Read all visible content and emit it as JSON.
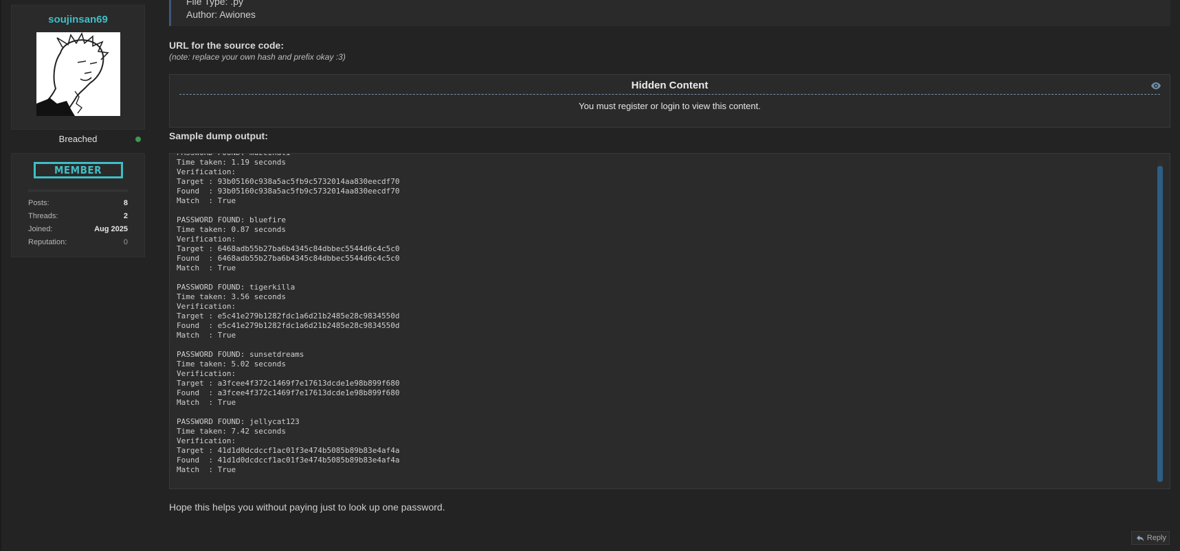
{
  "sidebar": {
    "username": "soujinsan69",
    "status": "Breached",
    "rank": "MEMBER",
    "stats": [
      {
        "label": "Posts:",
        "value": "8"
      },
      {
        "label": "Threads:",
        "value": "2"
      },
      {
        "label": "Joined:",
        "value": "Aug 2025"
      },
      {
        "label": "Reputation:",
        "value": "0"
      }
    ]
  },
  "quote": {
    "line1": "File Type: .py",
    "line2": "Author: Awiones"
  },
  "source": {
    "title": "URL for the source code:",
    "note": "(note: replace your own hash and prefix okay :3)"
  },
  "hidden": {
    "title": "Hidden Content",
    "message": "You must register or login to view this content."
  },
  "dump": {
    "title": "Sample dump output:",
    "code": "PASSWORD FOUND: muzcinati\nTime taken: 1.19 seconds\nVerification:\nTarget : 93b05160c938a5ac5fb9c5732014aa830eecdf70\nFound  : 93b05160c938a5ac5fb9c5732014aa830eecdf70\nMatch  : True\n\nPASSWORD FOUND: bluefire\nTime taken: 0.87 seconds\nVerification:\nTarget : 6468adb55b27ba6b4345c84dbbec5544d6c4c5c0\nFound  : 6468adb55b27ba6b4345c84dbbec5544d6c4c5c0\nMatch  : True\n\nPASSWORD FOUND: tigerkilla\nTime taken: 3.56 seconds\nVerification:\nTarget : e5c41e279b1282fdc1a6d21b2485e28c9834550d\nFound  : e5c41e279b1282fdc1a6d21b2485e28c9834550d\nMatch  : True\n\nPASSWORD FOUND: sunsetdreams\nTime taken: 5.02 seconds\nVerification:\nTarget : a3fcee4f372c1469f7e17613dcde1e98b899f680\nFound  : a3fcee4f372c1469f7e17613dcde1e98b899f680\nMatch  : True\n\nPASSWORD FOUND: jellycat123\nTime taken: 7.42 seconds\nVerification:\nTarget : 41d1d0dcdccf1ac01f3e474b5085b89b83e4af4a\nFound  : 41d1d0dcdccf1ac01f3e474b5085b89b83e4af4a\nMatch  : True"
  },
  "closing": "Hope this helps you without paying just to look up one password.",
  "reply_label": "Reply",
  "colors": {
    "accent": "#3fbfc6",
    "online": "#3d9a4a",
    "scrollbar": "#2d5f86"
  }
}
